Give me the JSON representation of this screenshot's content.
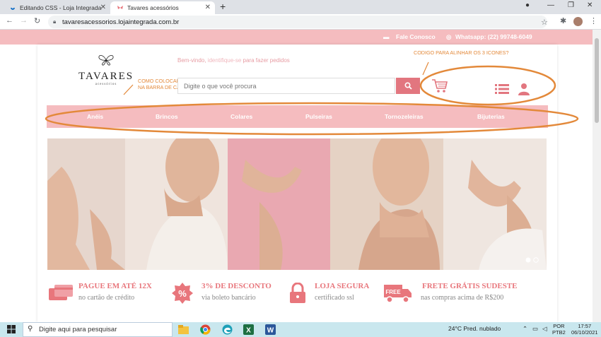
{
  "browser": {
    "tabs": [
      {
        "label": "Editando CSS - Loja Integrada",
        "active": false
      },
      {
        "label": "Tavares acessórios",
        "active": true
      }
    ],
    "new_tab": "+",
    "url": "tavaresacessorios.lojaintegrada.com.br"
  },
  "site": {
    "topbar": {
      "contact": "Fale Conosco",
      "whatsapp": "Whatsapp: (22) 99748-6049"
    },
    "logo": {
      "name": "TAVARES",
      "tagline": "acessórios"
    },
    "welcome": {
      "prefix": "Bem-vindo,",
      "link": "identifique-se",
      "suffix": "para fazer pedidos"
    },
    "search": {
      "placeholder": "Digite o que você procura"
    },
    "annotations": {
      "icons_question": "CODIGO PARA ALINHAR OS 3 ICONES?",
      "category_question_line1": "COMO COLOCAR OS ICONES",
      "category_question_line2": "NA BARRA DE CAATEGORIAS?"
    },
    "nav": [
      "Anéis",
      "Brincos",
      "Colares",
      "Pulseiras",
      "Tornozeleiras",
      "Bijuterias"
    ],
    "benefits": [
      {
        "title": "PAGUE EM ATÉ 12X",
        "subtitle": "no cartão de crédito",
        "icon": "credit-card-icon"
      },
      {
        "title": "3% DE DESCONTO",
        "subtitle": "via boleto bancário",
        "icon": "percent-badge-icon"
      },
      {
        "title": "LOJA SEGURA",
        "subtitle": "certificado ssl",
        "icon": "padlock-icon"
      },
      {
        "title": "FRETE GRÁTIS SUDESTE",
        "subtitle": "nas compras acima de R$200",
        "icon": "free-shipping-truck-icon"
      }
    ],
    "colors": {
      "brand_pink": "#f5bcbf",
      "accent": "#e8767c",
      "annotation_orange": "#e3893a"
    }
  },
  "taskbar": {
    "search_placeholder": "Digite aqui para pesquisar",
    "weather": "24°C  Pred. nublado",
    "lang_top": "POR",
    "lang_bottom": "PTB2",
    "time": "17:57",
    "date": "06/10/2021"
  }
}
